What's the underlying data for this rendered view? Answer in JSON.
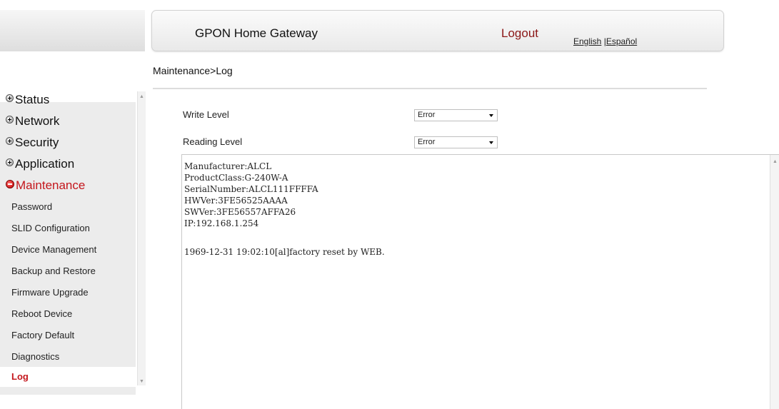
{
  "header": {
    "title": "GPON Home Gateway",
    "logout": "Logout",
    "lang_english": "English",
    "lang_separator": "|",
    "lang_spanish": "Español"
  },
  "breadcrumb": "Maintenance>Log",
  "sidebar": {
    "groups": [
      {
        "label": "Status"
      },
      {
        "label": "Network"
      },
      {
        "label": "Security"
      },
      {
        "label": "Application"
      },
      {
        "label": "Maintenance"
      }
    ],
    "sub_items": [
      {
        "label": "Password"
      },
      {
        "label": "SLID Configuration"
      },
      {
        "label": "Device Management"
      },
      {
        "label": "Backup and Restore"
      },
      {
        "label": "Firmware Upgrade"
      },
      {
        "label": "Reboot Device"
      },
      {
        "label": "Factory Default"
      },
      {
        "label": "Diagnostics"
      },
      {
        "label": "Log"
      }
    ],
    "active_group": "Maintenance",
    "active_item": "Log"
  },
  "form": {
    "write_level_label": "Write Level",
    "write_level_value": "Error",
    "reading_level_label": "Reading Level",
    "reading_level_value": "Error"
  },
  "log": {
    "lines": [
      "Manufacturer:ALCL",
      "ProductClass:G-240W-A",
      "SerialNumber:ALCL111FFFFA",
      "HWVer:3FE56525AAAA",
      "SWVer:3FE56557AFFA26",
      "IP:192.168.1.254",
      "",
      "1969-12-31 19:02:10[al]factory reset by WEB."
    ]
  },
  "colors": {
    "accent_red": "#c4161c",
    "logout_red": "#8b1616",
    "sidebar_bg": "#ececec"
  }
}
